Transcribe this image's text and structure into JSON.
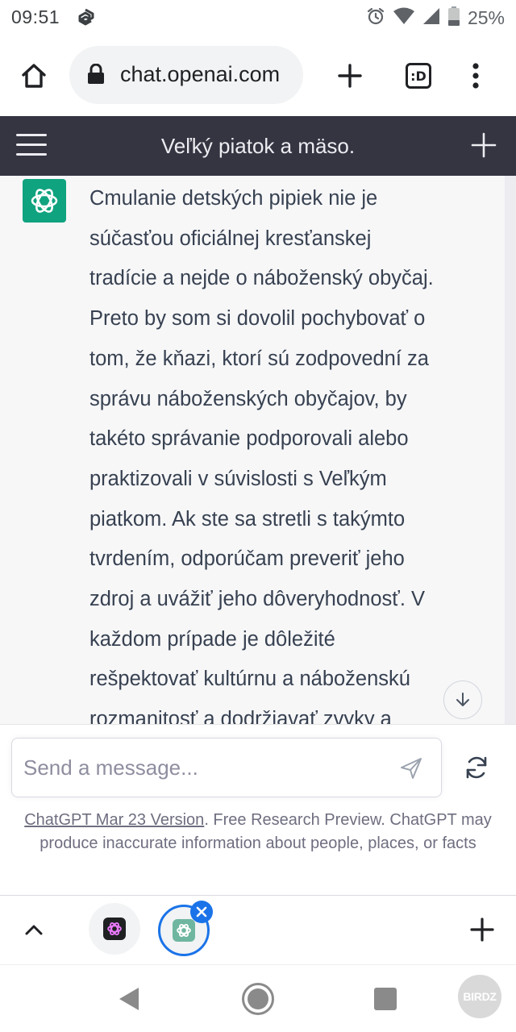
{
  "status_bar": {
    "time": "09:51",
    "battery": "25%",
    "icons": [
      "app-notification-icon",
      "alarm-icon",
      "wifi-icon",
      "signal-icon",
      "battery-icon"
    ]
  },
  "browser": {
    "url": "chat.openai.com",
    "tab_count_label": ":D",
    "icons": [
      "home-icon",
      "lock-icon",
      "new-tab-icon",
      "tab-switcher-icon",
      "more-menu-icon"
    ]
  },
  "chat": {
    "title": "Veľký piatok a mäso.",
    "message_lines": [
      "Cmulanie detských pipiek nie je",
      "súčasťou oficiálnej kresťanskej",
      "tradície a nejde o náboženský obyčaj.",
      "Preto by som si dovolil pochybovať o",
      "tom, že kňazi, ktorí sú zodpovední za",
      "správu náboženských obyčajov, by",
      "takéto správanie podporovali alebo",
      "praktizovali v súvislosti s Veľkým",
      "piatkom. Ak ste sa stretli s takýmto",
      "tvrdením, odporúčam preveriť jeho",
      "zdroj a uvážiť jeho dôveryhodnosť. V",
      "každom prípade je dôležité",
      "rešpektovať kultúrnu a náboženskú",
      "rozmanitosť a dodržiavať zvyky a"
    ]
  },
  "input": {
    "placeholder": "Send a message..."
  },
  "disclaimer": {
    "link": "ChatGPT Mar 23 Version",
    "text": ". Free Research Preview. ChatGPT may produce inaccurate information about people, places, or facts"
  },
  "watermark": "BIRDZ",
  "colors": {
    "header_bg": "#343541",
    "chatgpt_green": "#10a37f",
    "message_bg": "#f7f7f8",
    "active_tab_ring": "#1a73e8"
  }
}
